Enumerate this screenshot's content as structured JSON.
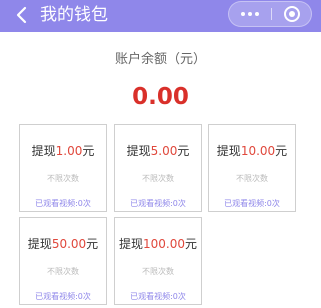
{
  "header": {
    "title": "我的钱包",
    "back_icon": "chevron-left-icon",
    "more_icon": "more-dots-icon",
    "close_icon": "target-close-icon",
    "background": "#8f87ea"
  },
  "balance": {
    "label": "账户余额（元）",
    "value": "0.00",
    "value_color": "#d9302a"
  },
  "cards": [
    {
      "prefix": "提现",
      "amount": "1.00",
      "suffix": "元",
      "limit": "不限次数",
      "watched": "已观看视频:0次"
    },
    {
      "prefix": "提现",
      "amount": "5.00",
      "suffix": "元",
      "limit": "不限次数",
      "watched": "已观看视频:0次"
    },
    {
      "prefix": "提现",
      "amount": "10.00",
      "suffix": "元",
      "limit": "不限次数",
      "watched": "已观看视频:0次"
    },
    {
      "prefix": "提现",
      "amount": "50.00",
      "suffix": "元",
      "limit": "不限次数",
      "watched": "已观看视频:0次"
    },
    {
      "prefix": "提现",
      "amount": "100.00",
      "suffix": "元",
      "limit": "不限次数",
      "watched": "已观看视频:0次"
    }
  ],
  "colors": {
    "amount": "#e0483c",
    "watched": "#8f87ea",
    "card_border": "#cfcfcf"
  }
}
